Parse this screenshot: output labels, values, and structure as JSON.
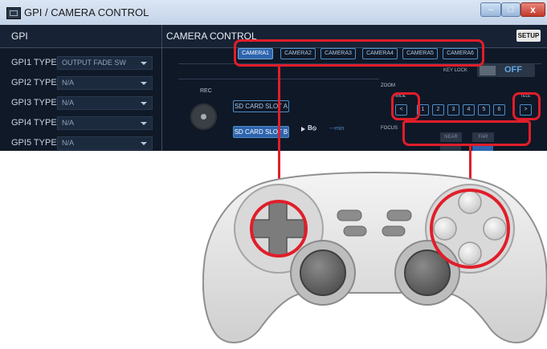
{
  "window": {
    "title": "GPI / CAMERA CONTROL",
    "controls": {
      "minimize": "–",
      "maximize": "□",
      "close": "x"
    }
  },
  "gpi": {
    "header": "GPI",
    "rows": [
      {
        "label": "GPI1 TYPE",
        "value": "OUTPUT FADE SW"
      },
      {
        "label": "GPI2 TYPE",
        "value": "N/A"
      },
      {
        "label": "GPI3 TYPE",
        "value": "N/A"
      },
      {
        "label": "GPI4 TYPE",
        "value": "N/A"
      },
      {
        "label": "GPI5 TYPE",
        "value": "N/A"
      }
    ]
  },
  "camera": {
    "header": "CAMERA CONTROL",
    "setup_label": "SETUP",
    "tabs": [
      "CAMERA1",
      "CAMERA2",
      "CAMERA3",
      "CAMERA4",
      "CAMERA5",
      "CAMERA6"
    ],
    "active_tab": "CAMERA1",
    "key_lock": {
      "label": "KEY LOCK",
      "value": "OFF"
    },
    "rec": {
      "label": "REC",
      "slot_a": "SD CARD SLOT A",
      "slot_b": "SD CARD SLOT B",
      "remaining": "---min"
    },
    "zoom": {
      "label": "ZOOM",
      "wide_label": "WIDE",
      "tele_label": "TELE",
      "wide_btn": "<",
      "tele_btn": ">",
      "presets": [
        "1",
        "2",
        "3",
        "4",
        "5",
        "6"
      ]
    },
    "focus": {
      "label": "FOCUS",
      "near": "NEAR",
      "far": "FAR"
    }
  },
  "colors": {
    "highlight": "#e01e2a",
    "active_tab": "#2d64ad",
    "accent_blue": "#4c8dc7"
  },
  "icons": {
    "app": "window-app-icon",
    "rec": "record-button-icon",
    "play": "play-icon",
    "sd": "sd-card-icon",
    "dpad": "dpad-icon",
    "face_buttons": "face-buttons-icon"
  }
}
